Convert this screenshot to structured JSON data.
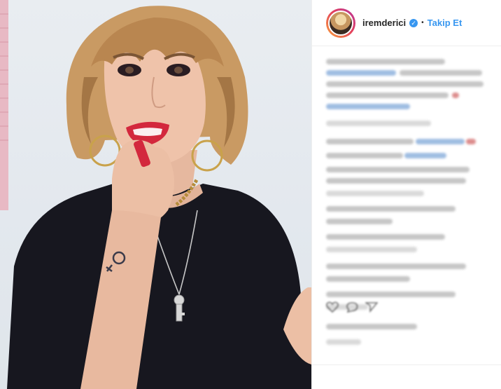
{
  "post": {
    "username": "iremderici",
    "verified_symbol": "✓",
    "separator": "•",
    "follow_label": "Takip Et"
  },
  "colors": {
    "accent": "#3897f0",
    "text": "#262626",
    "shirt": "#17171f",
    "lipstick": "#d3283d",
    "hair": "#c99a63"
  },
  "icons": [
    "verified-icon",
    "heart-icon",
    "comment-icon",
    "share-icon"
  ]
}
